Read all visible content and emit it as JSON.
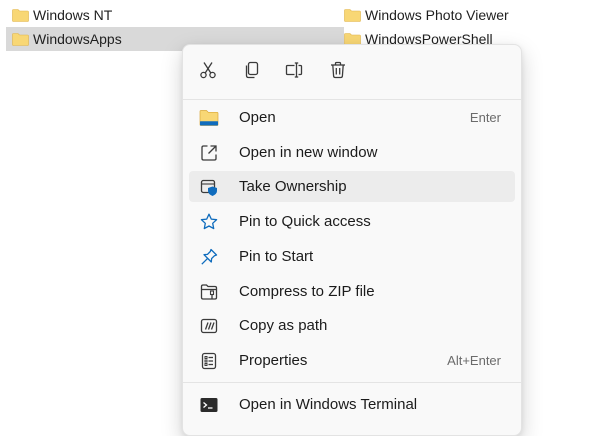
{
  "files": {
    "left": [
      {
        "name": "Windows NT"
      },
      {
        "name": "WindowsApps",
        "selected": true
      }
    ],
    "right": [
      {
        "name": "Windows Photo Viewer"
      },
      {
        "name": "WindowsPowerShell"
      }
    ]
  },
  "context_menu": {
    "quick_actions": [
      {
        "icon": "cut-icon"
      },
      {
        "icon": "copy-icon"
      },
      {
        "icon": "rename-icon"
      },
      {
        "icon": "delete-icon"
      }
    ],
    "items": [
      {
        "label": "Open",
        "shortcut": "Enter",
        "icon": "folder-icon"
      },
      {
        "label": "Open in new window",
        "icon": "open-new-window-icon"
      },
      {
        "label": "Take Ownership",
        "icon": "shield-icon",
        "hovered": true
      },
      {
        "label": "Pin to Quick access",
        "icon": "star-icon"
      },
      {
        "label": "Pin to Start",
        "icon": "pin-icon"
      },
      {
        "label": "Compress to ZIP file",
        "icon": "zip-folder-icon"
      },
      {
        "label": "Copy as path",
        "icon": "copy-path-icon"
      },
      {
        "label": "Properties",
        "shortcut": "Alt+Enter",
        "icon": "properties-icon"
      },
      {
        "label": "Open in Windows Terminal",
        "icon": "terminal-icon"
      }
    ]
  },
  "colors": {
    "folder_yellow": "#f8d775",
    "accent_blue": "#0f6cbd",
    "selection_gray": "#d9d9d9",
    "hover_gray": "#ececec"
  }
}
